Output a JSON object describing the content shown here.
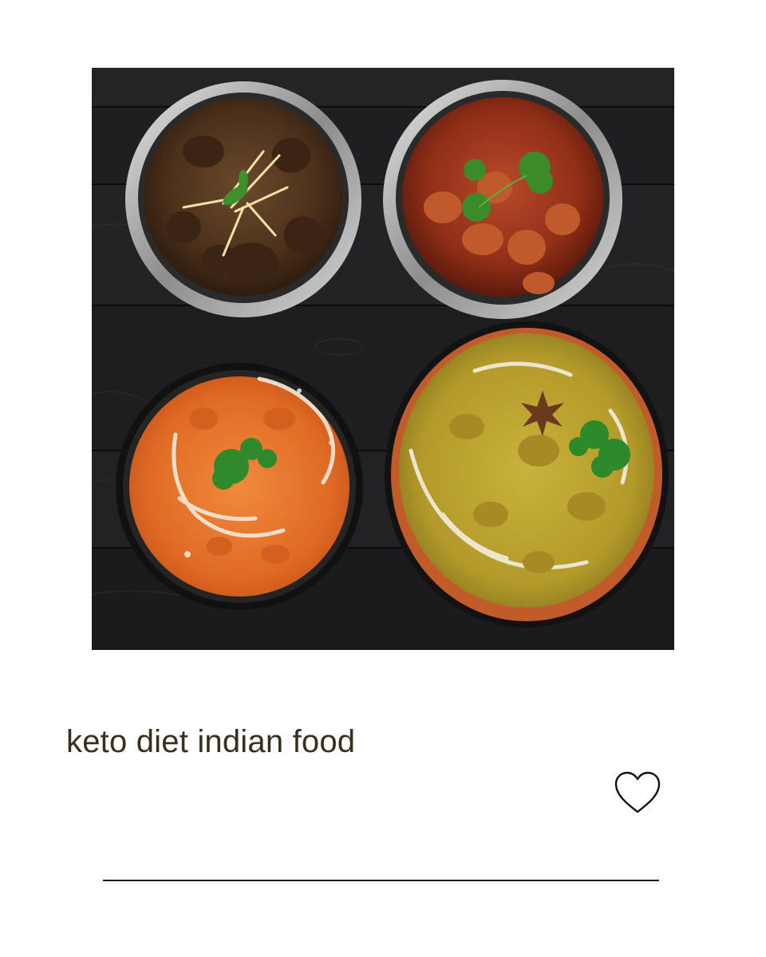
{
  "post": {
    "title": "keto diet indian food",
    "image_icon": "curry-bowls-photo",
    "like_icon": "heart-outline-icon"
  },
  "colors": {
    "title": "#3a2f1c",
    "table_wood": "#1d1d1f",
    "divider": "#1a1a1a"
  }
}
